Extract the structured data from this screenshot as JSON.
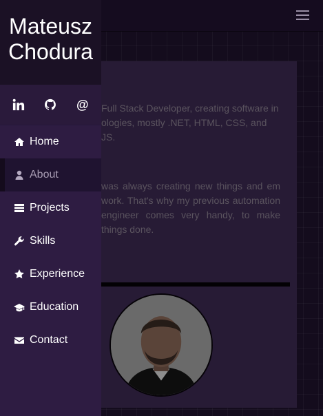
{
  "brand": {
    "name_line1": "Mateusz",
    "name_line2": "Chodura"
  },
  "socials": [
    {
      "label": "in",
      "icon": "linkedin-icon"
    },
    {
      "label": "",
      "icon": "github-icon"
    },
    {
      "label": "@",
      "icon": "email-at-icon"
    }
  ],
  "nav": {
    "items": [
      {
        "label": "Home",
        "icon": "home-icon"
      },
      {
        "label": "About",
        "icon": "user-icon",
        "active": true
      },
      {
        "label": "Projects",
        "icon": "projects-icon"
      },
      {
        "label": "Skills",
        "icon": "wrench-icon"
      },
      {
        "label": "Experience",
        "icon": "star-icon"
      },
      {
        "label": "Education",
        "icon": "graduation-cap-icon"
      },
      {
        "label": "Contact",
        "icon": "envelope-icon"
      }
    ]
  },
  "content": {
    "intro": "Full Stack Developer, creating software in ologies, mostly .NET, HTML, CSS, and JS.",
    "bio": "was always creating new things and em work. That's why my previous automation engineer comes very handy, to make things done."
  },
  "colors": {
    "sidebar": "#2e1c42",
    "brand_bg": "#1b1125",
    "card": "#3d2a52",
    "page_bg": "#140c1d"
  }
}
